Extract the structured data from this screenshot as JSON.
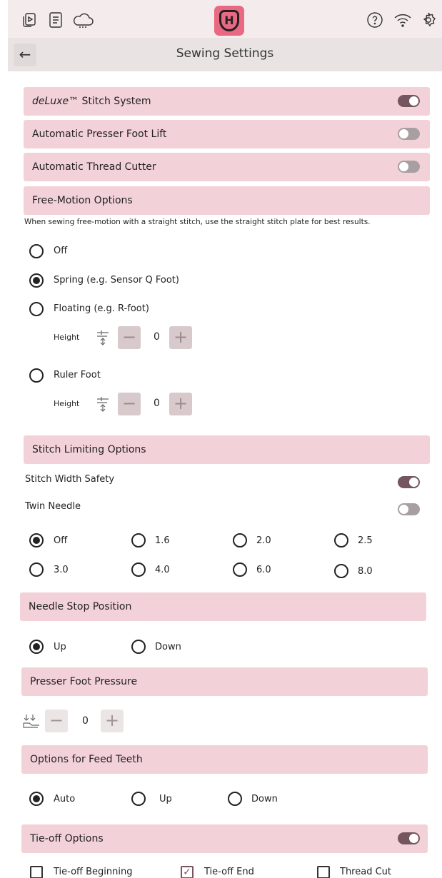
{
  "header": {
    "icons": [
      "stitch-creator-icon",
      "quick-guide-icon",
      "cloud-icon",
      "brand-logo",
      "help-icon",
      "wifi-icon",
      "settings-icon"
    ],
    "brand_letter": "H",
    "title": "Sewing Settings",
    "back_icon": "←"
  },
  "toggles": {
    "deluxe_brand": "deLuxe",
    "deluxe_rest": "™ Stitch System",
    "deluxe_on": true,
    "auto_lift": "Automatic Presser Foot Lift",
    "auto_lift_on": false,
    "thread_cutter": "Automatic Thread Cutter",
    "thread_cutter_on": false
  },
  "free_motion": {
    "title": "Free-Motion Options",
    "note": "When sewing free-motion with a straight stitch, use the straight stitch plate for best results.",
    "options": [
      "Off",
      "Spring (e.g. Sensor Q Foot)",
      "Floating (e.g. R-foot)",
      "Ruler Foot"
    ],
    "selected": "Spring (e.g. Sensor Q Foot)",
    "height_label": "Height",
    "floating_height": "0",
    "ruler_height": "0"
  },
  "stitch_limiting": {
    "title": "Stitch Limiting Options",
    "width_safety": "Stitch Width Safety",
    "width_safety_on": true,
    "twin_needle": "Twin Needle",
    "twin_needle_on": false,
    "values": [
      "Off",
      "1.6",
      "2.0",
      "2.5",
      "3.0",
      "4.0",
      "6.0",
      "8.0"
    ],
    "selected": "Off"
  },
  "needle_stop": {
    "title": "Needle Stop Position",
    "options": [
      "Up",
      "Down"
    ],
    "selected": "Up"
  },
  "presser_pressure": {
    "title": "Presser Foot Pressure",
    "value": "0"
  },
  "feed_teeth": {
    "title": "Options for Feed Teeth",
    "options": [
      "Auto",
      "Up",
      "Down"
    ],
    "selected": "Auto"
  },
  "tie_off": {
    "title": "Tie-off Options",
    "on": true,
    "options": [
      "Tie-off Beginning",
      "Tie-off End",
      "Thread Cut"
    ],
    "checked": [
      "Tie-off End"
    ]
  },
  "colors": {
    "bar": "#f3d1d9",
    "accent": "#75565f",
    "logo": "#e96882"
  }
}
